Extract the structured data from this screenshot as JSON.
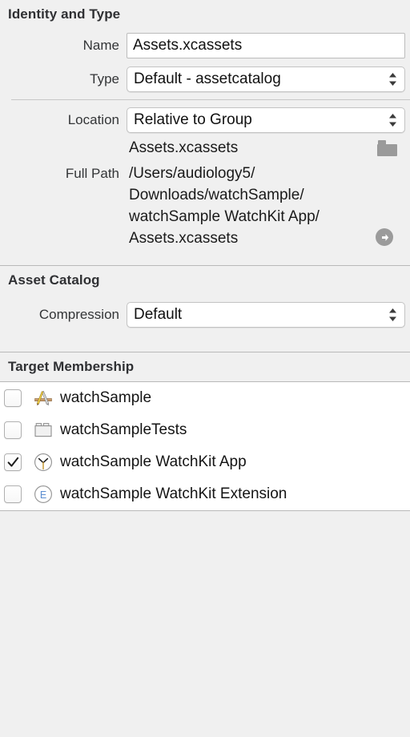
{
  "sections": {
    "identity": {
      "title": "Identity and Type",
      "name_label": "Name",
      "name_value": "Assets.xcassets",
      "name_placeholder": "Name",
      "type_label": "Type",
      "type_value": "Default - assetcatalog",
      "location_label": "Location",
      "location_value": "Relative to Group",
      "relative_path": "Assets.xcassets",
      "full_path_label": "Full Path",
      "full_path_value": "/Users/audiology5/\nDownloads/watchSample/\nwatchSample WatchKit App/\nAssets.xcassets"
    },
    "asset_catalog": {
      "title": "Asset Catalog",
      "compression_label": "Compression",
      "compression_value": "Default"
    },
    "target_membership": {
      "title": "Target Membership",
      "rows": [
        {
          "label": "watchSample",
          "checked": false,
          "icon": "xcode-app-icon"
        },
        {
          "label": "watchSampleTests",
          "checked": false,
          "icon": "test-bundle-icon"
        },
        {
          "label": "watchSample WatchKit App",
          "checked": true,
          "icon": "watch-app-icon"
        },
        {
          "label": "watchSample WatchKit Extension",
          "checked": false,
          "icon": "extension-e-icon"
        }
      ]
    }
  },
  "colors": {
    "panel_background": "#f0f0f0",
    "list_background": "#ffffff",
    "separator": "#b9b9b9",
    "text_primary": "#141414",
    "label_text": "#333537",
    "extension_blue": "#5b8dd0",
    "icon_gray": "#9a9a9a"
  }
}
